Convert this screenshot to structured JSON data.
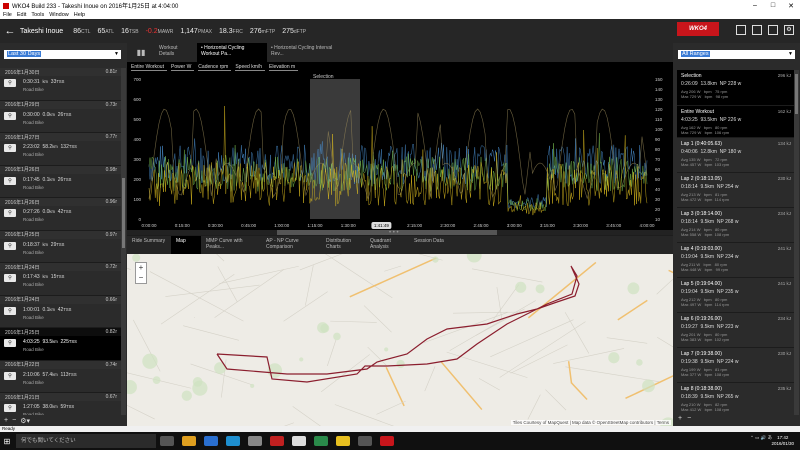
{
  "window": {
    "title": "WKO4 Build 233 - Takeshi Inoue on 2016年1月25日 at 4:04:00",
    "minimize": "–",
    "maximize": "□",
    "close": "✕"
  },
  "menu": [
    "File",
    "Edit",
    "Tools",
    "Window",
    "Help"
  ],
  "header": {
    "back": "←",
    "athlete": "Takeshi Inoue",
    "metrics": [
      {
        "value": "86",
        "unit": "CTL",
        "negative": false
      },
      {
        "value": "65",
        "unit": "ATL",
        "negative": false
      },
      {
        "value": "16",
        "unit": "TSB",
        "negative": false
      },
      {
        "value": "-0.2",
        "unit": "MAWR",
        "negative": true
      },
      {
        "value": "1,147",
        "unit": "PMAX",
        "negative": false
      },
      {
        "value": "18.3",
        "unit": "FRC",
        "negative": false
      },
      {
        "value": "276",
        "unit": "mFTP",
        "negative": false
      },
      {
        "value": "275",
        "unit": "dFTP",
        "negative": false
      }
    ],
    "logo": "WKO4"
  },
  "left": {
    "filter": "Last 30 Days",
    "workouts": [
      {
        "date": "2016年1月30日",
        "if": "0.81r",
        "time": "0:30:31",
        "dist": "",
        "tss": "33",
        "type": "Road Bike",
        "sel": false
      },
      {
        "date": "2016年1月29日",
        "if": "0.73r",
        "time": "0:30:00",
        "dist": "0.0",
        "tss": "26",
        "type": "Road Bike",
        "sel": false
      },
      {
        "date": "2016年1月27日",
        "if": "0.77r",
        "time": "2:23:02",
        "dist": "58.2",
        "tss": "132",
        "type": "Road Bike",
        "sel": false
      },
      {
        "date": "2016年1月26日",
        "if": "0.98r",
        "time": "0:17:45",
        "dist": "0.1",
        "tss": "26",
        "type": "Road Bike",
        "sel": false
      },
      {
        "date": "2016年1月26日",
        "if": "0.96r",
        "time": "0:27:26",
        "dist": "0.0",
        "tss": "42",
        "type": "Road Bike",
        "sel": false
      },
      {
        "date": "2016年1月25日",
        "if": "0.97r",
        "time": "0:18:37",
        "dist": "",
        "tss": "29",
        "type": "Road Bike",
        "sel": false
      },
      {
        "date": "2016年1月24日",
        "if": "0.72r",
        "time": "0:17:43",
        "dist": "",
        "tss": "15",
        "type": "Road Bike",
        "sel": false
      },
      {
        "date": "2016年1月24日",
        "if": "0.66r",
        "time": "1:00:01",
        "dist": "0.1",
        "tss": "42",
        "type": "Road Bike",
        "sel": false
      },
      {
        "date": "2016年1月25日",
        "if": "0.82r",
        "time": "4:03:25",
        "dist": "93.5",
        "tss": "225",
        "type": "Road Bike",
        "sel": true
      },
      {
        "date": "2016年1月22日",
        "if": "0.74r",
        "time": "2:10:06",
        "dist": "57.4",
        "tss": "113",
        "type": "Road Bike",
        "sel": false
      },
      {
        "date": "2016年1月21日",
        "if": "0.67r",
        "time": "1:27:05",
        "dist": "38.0",
        "tss": "59",
        "type": "Road Bike",
        "sel": false
      },
      {
        "date": "2016年1月20日",
        "if": "0.80r",
        "time": "",
        "dist": "",
        "tss": "",
        "type": "",
        "sel": false
      }
    ]
  },
  "center": {
    "tabs": [
      "Workout Details",
      "• Horizontal Cycling Workout Pa...",
      "• Horizontal Cycling Interval Rev..."
    ],
    "plot_controls": [
      "Entire Workout",
      "Power",
      "W",
      "Cadence",
      "rpm",
      "Speed",
      "km/h",
      "Elevation",
      "m"
    ],
    "selection_label": "Selection",
    "x_ticks": [
      "0:00:00",
      "0:15:00",
      "0:30:00",
      "0:45:00",
      "1:00:00",
      "1:15:00",
      "1:30:00",
      "1:41:49",
      "2:15:00",
      "2:30:00",
      "2:45:00",
      "3:00:00",
      "3:15:00",
      "3:30:00",
      "3:45:00",
      "4:00:00"
    ],
    "axis_x_label": "h:m:s",
    "y_ticks_left": [
      "700",
      "600",
      "500",
      "400",
      "300",
      "200",
      "100",
      "0"
    ],
    "y_ticks_right": [
      "150",
      "140",
      "130",
      "120",
      "110",
      "100",
      "90",
      "80",
      "70",
      "60",
      "50",
      "40",
      "30",
      "20",
      "10"
    ],
    "sub_tabs": [
      "Ride Summary",
      "Map",
      "MMP Curve with Peaks...",
      "AP - NP Curve Comparison",
      "Distribution Charts",
      "Quadrant Analysis",
      "Session Data"
    ],
    "map_attr": "Tiles Courtesy of MapQuest | Map data © OpenStreetMap contributors | Terms"
  },
  "right": {
    "filter": "All Ranges",
    "ranges": [
      {
        "name": "Selection",
        "work": "296 kJ",
        "time": "0:26:09",
        "dist": "13.8",
        "np": "NP 228 w",
        "detail": "Avg 206 W   bpm   75 rpm\nMax 729 W   bpm   98 rpm"
      },
      {
        "name": "Entire Workout",
        "work": "162 kJ",
        "time": "4:03:25",
        "dist": "93.5",
        "np": "NP 226 w",
        "detail": "Avg 162 W   bpm   80 rpm\nMax 729 W   bpm  106 rpm"
      },
      {
        "name": "Lap 1 (0:40:05.63)",
        "work": "134 kJ",
        "time": "0:40:06",
        "dist": "12.8",
        "np": "NP 180 w",
        "detail": "Avg 135 W   bpm   72 rpm\nMax 457 W   bpm  103 rpm"
      },
      {
        "name": "Lap 2 (0:18:13.05)",
        "work": "230 kJ",
        "time": "0:18:14",
        "dist": "9.5",
        "np": "NP 254 w",
        "detail": "Avg 213 W   bpm   81 rpm\nMax 472 W   bpm  114 rpm"
      },
      {
        "name": "Lap 3 (0:18:14.00)",
        "work": "234 kJ",
        "time": "0:18:14",
        "dist": "9.5",
        "np": "NP 268 w",
        "detail": "Avg 214 W   bpm   80 rpm\nMax 558 W   bpm  108 rpm"
      },
      {
        "name": "Lap 4 (0:19:03.00)",
        "work": "241 kJ",
        "time": "0:19:04",
        "dist": "9.5",
        "np": "NP 234 w",
        "detail": "Avg 211 W   bpm   80 rpm\nMax 448 W   bpm   99 rpm"
      },
      {
        "name": "Lap 5 (0:19:04.00)",
        "work": "241 kJ",
        "time": "0:19:04",
        "dist": "9.5",
        "np": "NP 235 w",
        "detail": "Avg 212 W   bpm   80 rpm\nMax 497 W   bpm  114 rpm"
      },
      {
        "name": "Lap 6 (0:19:26.00)",
        "work": "234 kJ",
        "time": "0:19:27",
        "dist": "9.5",
        "np": "NP 223 w",
        "detail": "Avg 201 W   bpm   80 rpm\nMax 383 W   bpm  102 rpm"
      },
      {
        "name": "Lap 7 (0:19:38.00)",
        "work": "230 kJ",
        "time": "0:19:38",
        "dist": "9.5",
        "np": "NP 224 w",
        "detail": "Avg 199 W   bpm   81 rpm\nMax 377 W   bpm  108 rpm"
      },
      {
        "name": "Lap 8 (0:18:38.00)",
        "work": "235 kJ",
        "time": "0:18:39",
        "dist": "9.5",
        "np": "NP 265 w",
        "detail": "Avg 210 W   bpm   82 rpm\nMax 412 W   bpm  108 rpm"
      }
    ]
  },
  "status": "Ready",
  "taskbar": {
    "search": "何でも聞いてください",
    "time": "17:42",
    "date": "2016/01/30"
  },
  "colors": {
    "accent": "#c8151b",
    "power": "#e0c020",
    "cadence": "#4a8fd0",
    "speed": "#7ac050",
    "route": "#8b1e2e"
  }
}
